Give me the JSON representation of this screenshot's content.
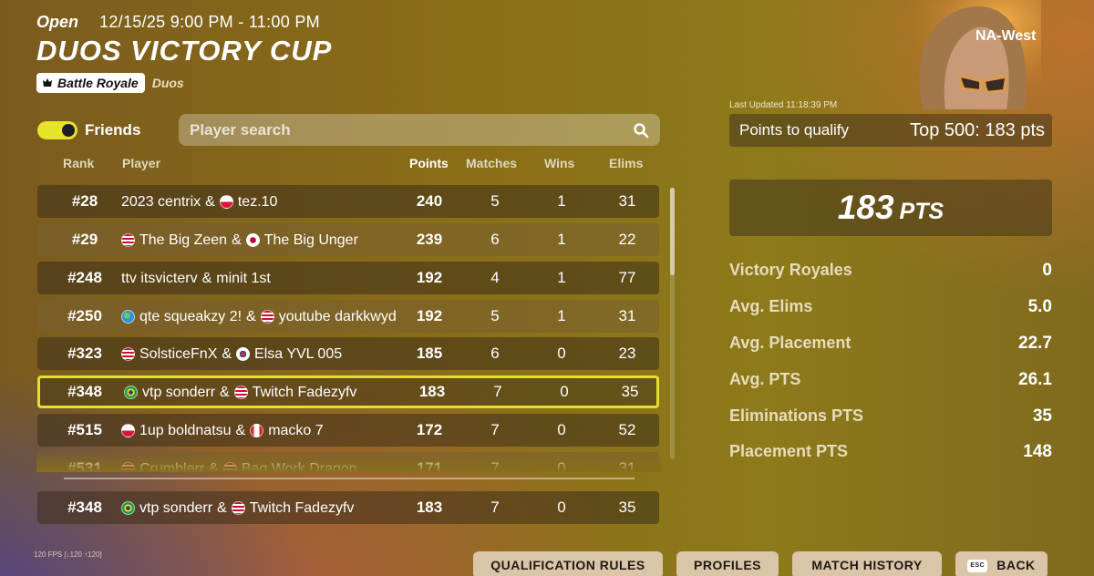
{
  "header": {
    "status": "Open",
    "datetime": "12/15/25 9:00 PM - 11:00 PM",
    "title": "DUOS VICTORY CUP",
    "mode_badge": "Battle Royale",
    "mode_sub": "Duos"
  },
  "friends_toggle": {
    "label": "Friends",
    "on": true
  },
  "search": {
    "placeholder": "Player search",
    "value": ""
  },
  "columns": [
    "Rank",
    "Player",
    "Points",
    "Matches",
    "Wins",
    "Elims"
  ],
  "rows": [
    {
      "rank": "#28",
      "p1": {
        "name": "2023 centrix",
        "flag": ""
      },
      "sep": "&",
      "p2": {
        "name": "tez.10",
        "flag": "poland"
      },
      "points": "240",
      "matches": "5",
      "wins": "1",
      "elims": "31"
    },
    {
      "rank": "#29",
      "p1": {
        "name": "The Big Zeen",
        "flag": "usa"
      },
      "sep": "&",
      "p2": {
        "name": "The Big Unger",
        "flag": "japan"
      },
      "points": "239",
      "matches": "6",
      "wins": "1",
      "elims": "22"
    },
    {
      "rank": "#248",
      "p1": {
        "name": "ttv itsvicterv",
        "flag": ""
      },
      "sep": "&",
      "p2": {
        "name": "minit 1st",
        "flag": ""
      },
      "points": "192",
      "matches": "4",
      "wins": "1",
      "elims": "77"
    },
    {
      "rank": "#250",
      "p1": {
        "name": "qte squeakzy 2!",
        "flag": "globe"
      },
      "sep": "&",
      "p2": {
        "name": "youtube darkkwyd",
        "flag": "usa"
      },
      "points": "192",
      "matches": "5",
      "wins": "1",
      "elims": "31"
    },
    {
      "rank": "#323",
      "p1": {
        "name": "SolsticeFnX",
        "flag": "usa"
      },
      "sep": "&",
      "p2": {
        "name": "Elsa YVL 005",
        "flag": "korea"
      },
      "points": "185",
      "matches": "6",
      "wins": "0",
      "elims": "23"
    },
    {
      "rank": "#348",
      "p1": {
        "name": "vtp sonderr",
        "flag": "brazil"
      },
      "sep": "&",
      "p2": {
        "name": "Twitch Fadezyfv",
        "flag": "usa"
      },
      "points": "183",
      "matches": "7",
      "wins": "0",
      "elims": "35",
      "highlight": true
    },
    {
      "rank": "#515",
      "p1": {
        "name": "1up boldnatsu",
        "flag": "poland"
      },
      "sep": "&",
      "p2": {
        "name": "macko 7",
        "flag": "canada"
      },
      "points": "172",
      "matches": "7",
      "wins": "0",
      "elims": "52"
    },
    {
      "rank": "#531",
      "p1": {
        "name": "Crumblerr",
        "flag": "usa"
      },
      "sep": "&",
      "p2": {
        "name": "Bag Work Dragon",
        "flag": "usa"
      },
      "points": "171",
      "matches": "7",
      "wins": "0",
      "elims": "31"
    }
  ],
  "self_row": {
    "rank": "#348",
    "p1": {
      "name": "vtp sonderr",
      "flag": "brazil"
    },
    "sep": "&",
    "p2": {
      "name": "Twitch Fadezyfv",
      "flag": "usa"
    },
    "points": "183",
    "matches": "7",
    "wins": "0",
    "elims": "35"
  },
  "side": {
    "region": "NA-West",
    "last_updated": "Last Updated 11:18:39 PM",
    "qualify_label": "Points to qualify",
    "qualify_value": "Top 500: 183 pts",
    "points_big": "183",
    "points_unit": "PTS",
    "stats": [
      {
        "label": "Victory Royales",
        "value": "0"
      },
      {
        "label": "Avg. Elims",
        "value": "5.0"
      },
      {
        "label": "Avg. Placement",
        "value": "22.7"
      },
      {
        "label": "Avg. PTS",
        "value": "26.1"
      },
      {
        "label": "Eliminations PTS",
        "value": "35"
      },
      {
        "label": "Placement PTS",
        "value": "148"
      }
    ]
  },
  "footer": {
    "fps": "120 FPS [↓120 ↑120]",
    "buttons": {
      "qualification_rules": "QUALIFICATION RULES",
      "profiles": "PROFILES",
      "match_history": "MATCH HISTORY",
      "esc": "ESC",
      "back": "BACK"
    }
  },
  "colors": {
    "accent": "#e4e02c",
    "button_bg": "#dbc5a8",
    "panel": "#3c2d19"
  },
  "flag_colors": {
    "usa": "#ffffff",
    "poland": "#ffffff",
    "japan": "#ffffff",
    "brazil": "#1b9a3e",
    "korea": "#ffffff",
    "canada": "#ffffff",
    "globe": "#3a8fd6"
  }
}
